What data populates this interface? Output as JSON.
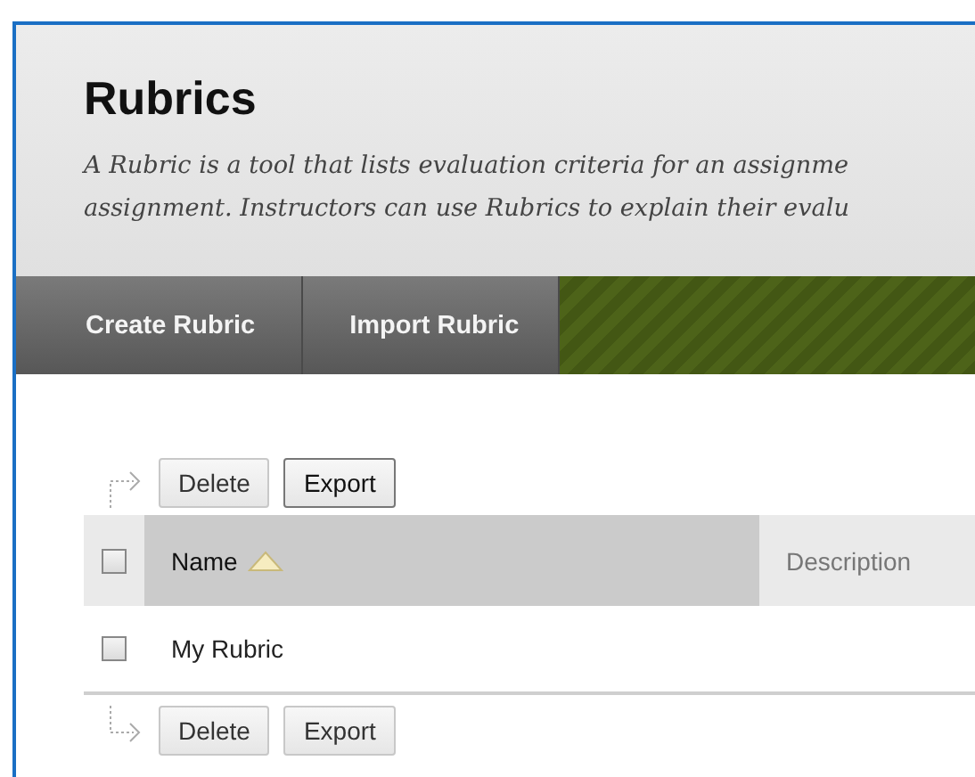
{
  "page": {
    "title": "Rubrics",
    "description_lines": [
      "A Rubric is a tool that lists evaluation criteria for an assignme",
      "assignment. Instructors can use Rubrics to explain their evalu"
    ]
  },
  "action_bar": [
    {
      "label": "Create Rubric"
    },
    {
      "label": "Import Rubric"
    }
  ],
  "top_toolbar": [
    {
      "label": "Delete",
      "focused": false
    },
    {
      "label": "Export",
      "focused": true
    }
  ],
  "table": {
    "select_all_checked": false,
    "columns": [
      {
        "label": "Name",
        "sorted": true
      },
      {
        "label": "Description",
        "sorted": false
      }
    ],
    "rows": [
      {
        "name": "My Rubric",
        "checked": false
      }
    ]
  },
  "bottom_toolbar": [
    {
      "label": "Delete",
      "focused": false
    },
    {
      "label": "Export",
      "focused": false
    }
  ]
}
